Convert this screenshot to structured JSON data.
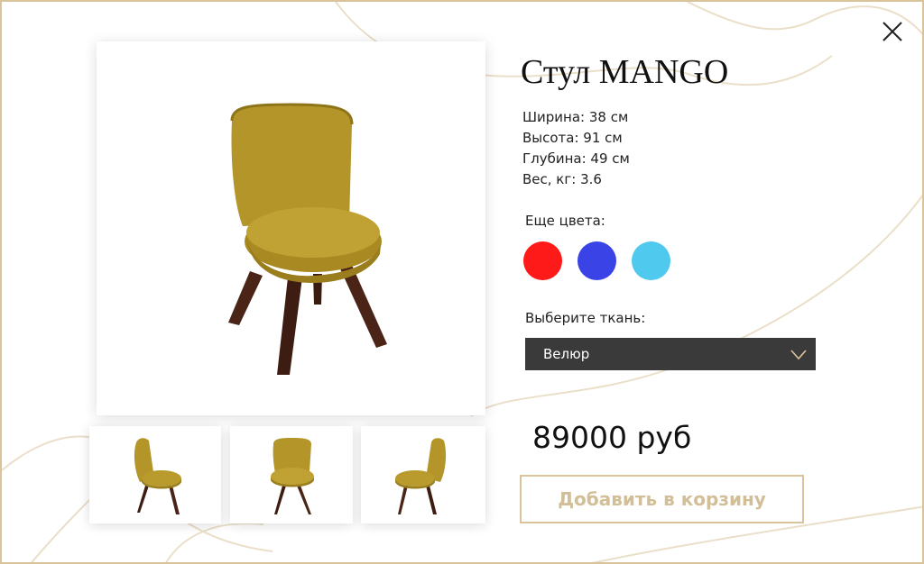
{
  "product": {
    "title": "Стул MANGO",
    "specs": [
      "Ширина: 38 см",
      "Высота: 91 см",
      "Глубина: 49 см",
      "Вес, кг: 3.6"
    ]
  },
  "colors": {
    "label": "Еще цвета:",
    "swatches": [
      "#ff1a1a",
      "#3a44e6",
      "#4fc9ee"
    ]
  },
  "fabric": {
    "label": "Выберите ткань:",
    "selected": "Велюр"
  },
  "price": "89000 руб",
  "cart_button": "Добавить в корзину",
  "icons": {
    "close": "close-icon",
    "dropdown": "chevron-down-icon"
  },
  "theme": {
    "accent": "#d9c39a",
    "chair_fabric": "#b4952a",
    "chair_legs": "#4a2417",
    "select_bg": "#3a3a3a"
  }
}
